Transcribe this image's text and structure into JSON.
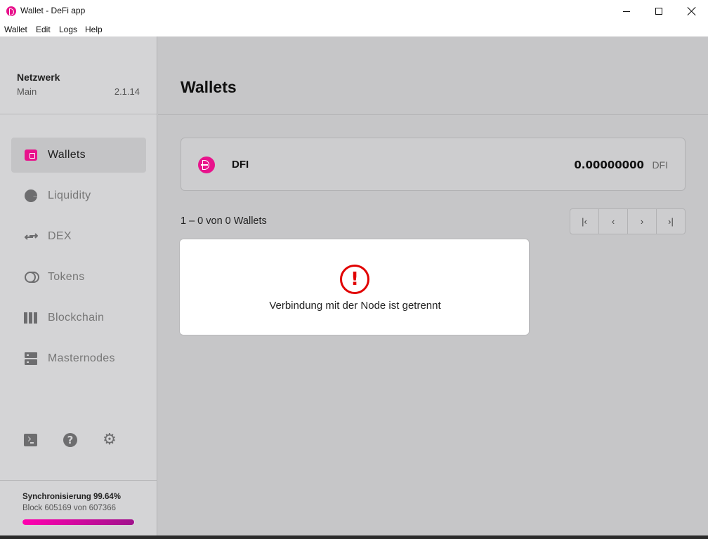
{
  "window": {
    "title": "Wallet - DeFi app"
  },
  "menubar": {
    "items": [
      "Wallet",
      "Edit",
      "Logs",
      "Help"
    ]
  },
  "sidebar": {
    "network_title": "Netzwerk",
    "network_name": "Main",
    "version": "2.1.14",
    "nav": [
      {
        "label": "Wallets",
        "icon": "wallet-icon",
        "active": true
      },
      {
        "label": "Liquidity",
        "icon": "pie-chart-icon",
        "active": false
      },
      {
        "label": "DEX",
        "icon": "swap-arrows-icon",
        "active": false
      },
      {
        "label": "Tokens",
        "icon": "tokens-icon",
        "active": false
      },
      {
        "label": "Blockchain",
        "icon": "blockchain-icon",
        "active": false
      },
      {
        "label": "Masternodes",
        "icon": "server-icon",
        "active": false
      }
    ],
    "utility_icons": [
      "console-icon",
      "help-icon",
      "settings-icon"
    ],
    "sync": {
      "label": "Synchronisierung 99.64%",
      "block_text": "Block 605169 von 607366",
      "progress_fraction": 0.9964
    }
  },
  "main": {
    "title": "Wallets",
    "token": {
      "name": "DFI",
      "balance": "0.00000000",
      "unit": "DFI",
      "icon": "dfi-logo-icon"
    },
    "pagination": {
      "summary": "1 – 0 von 0 Wallets",
      "buttons": [
        "first-page-icon",
        "prev-page-icon",
        "next-page-icon",
        "last-page-icon"
      ]
    },
    "error": {
      "icon": "error-circle-icon",
      "message": "Verbindung mit der Node ist getrennt"
    }
  },
  "colors": {
    "accent": "#e8138c",
    "error": "#e10000",
    "sidebar_bg": "#d4d4d6",
    "main_bg": "#c6c6c8"
  }
}
